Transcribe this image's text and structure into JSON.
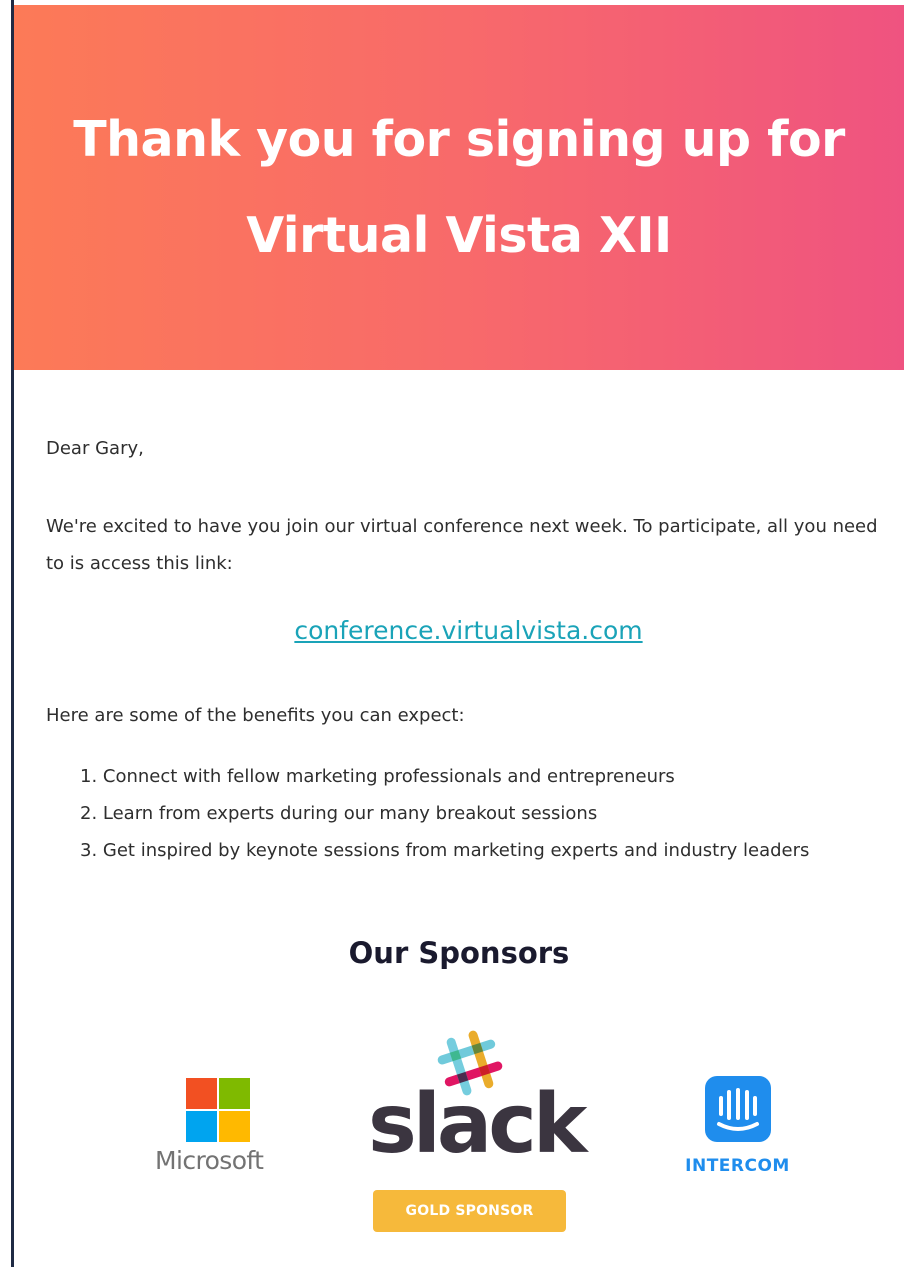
{
  "hero": {
    "title": "Thank you for signing up for Virtual Vista XII",
    "gradient_start": "#fc7a57",
    "gradient_end": "#ef5380"
  },
  "body": {
    "greeting": "Dear Gary,",
    "intro": "We're excited to have you join our virtual conference next week. To participate, all you need to is access this link:",
    "link_text": "conference.virtualvista.com",
    "link_color": "#1aa3b8",
    "benefits_intro": "Here are some of the benefits you can expect:",
    "benefits": [
      "1. Connect with fellow marketing professionals and entrepreneurs",
      "2. Learn from experts during our many breakout sessions",
      "3. Get inspired by keynote sessions from marketing experts and industry leaders"
    ]
  },
  "sponsors": {
    "title": "Our Sponsors",
    "microsoft": {
      "name": "Microsoft",
      "icon": "microsoft-logo-icon"
    },
    "slack": {
      "name": "slack",
      "badge": "GOLD SPONSOR",
      "icon": "slack-logo-icon",
      "badge_color": "#f6b93b"
    },
    "intercom": {
      "name": "INTERCOM",
      "icon": "intercom-logo-icon",
      "color": "#1f8ded"
    }
  }
}
